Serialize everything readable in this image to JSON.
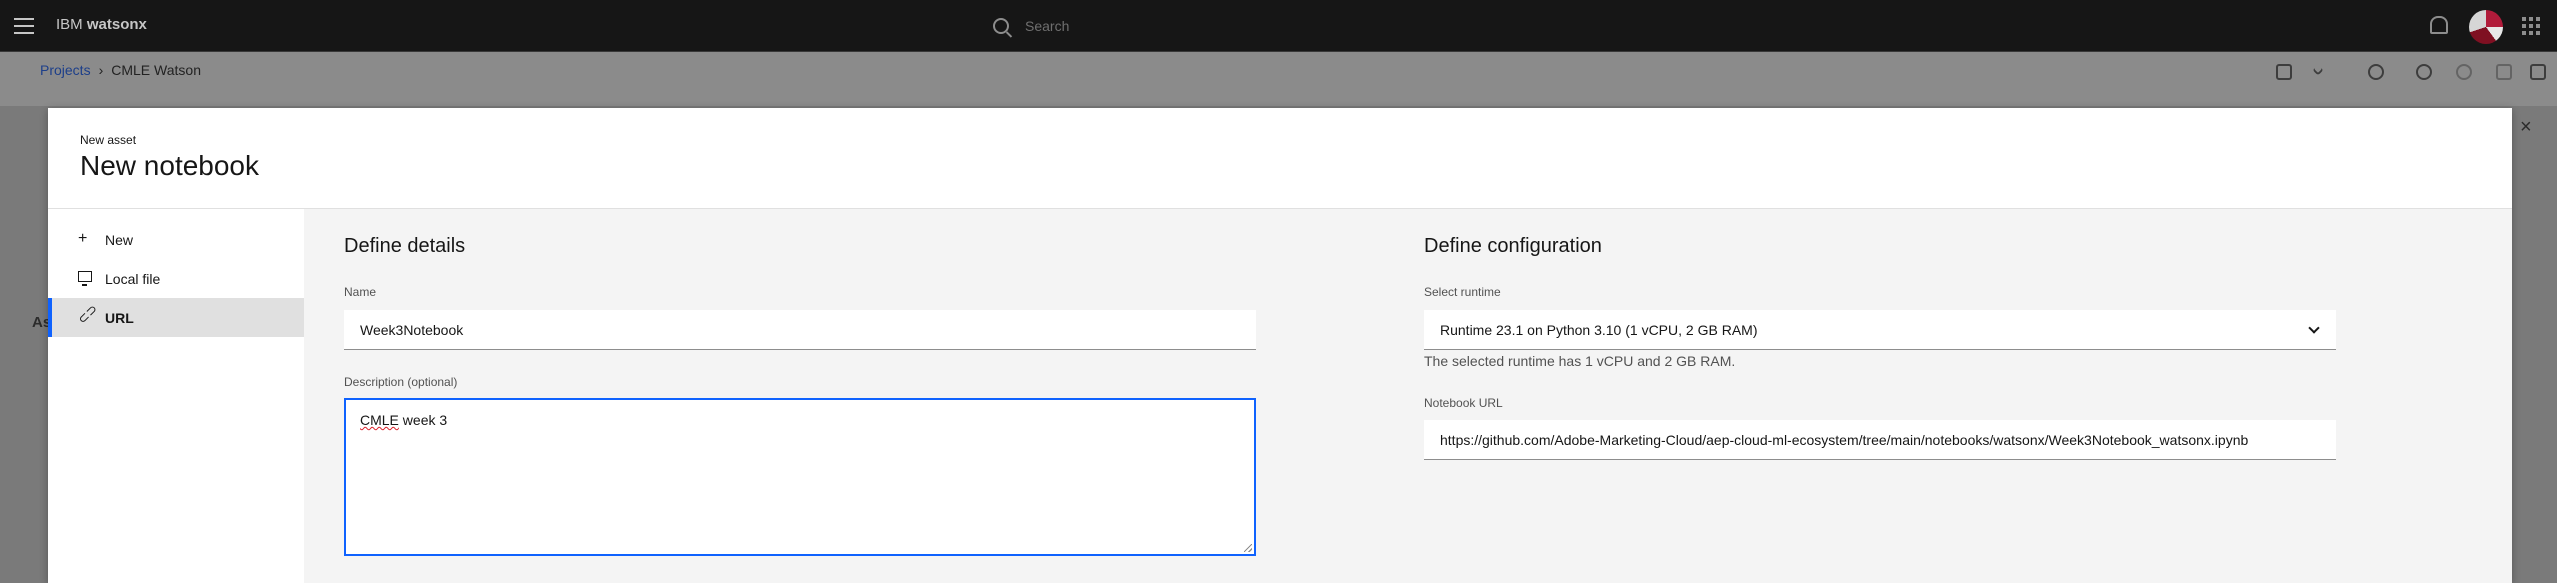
{
  "header": {
    "brand_prefix": "IBM",
    "brand_name": "watsonx",
    "search_placeholder": "Search"
  },
  "breadcrumb": {
    "projects_link": "Projects",
    "separator": "›",
    "current": "CMLE Watson"
  },
  "background_fragments": {
    "assets_partial": "As"
  },
  "modal": {
    "eyebrow": "New asset",
    "title": "New notebook",
    "nav": [
      {
        "label": "New",
        "icon": "plus-icon"
      },
      {
        "label": "Local file",
        "icon": "monitor-icon"
      },
      {
        "label": "URL",
        "icon": "link-icon"
      }
    ],
    "details": {
      "title": "Define details",
      "name_label": "Name",
      "name_value": "Week3Notebook",
      "description_label": "Description (optional)",
      "description_word1": "CMLE",
      "description_rest": " week 3"
    },
    "configuration": {
      "title": "Define configuration",
      "runtime_label": "Select runtime",
      "runtime_value": "Runtime 23.1 on Python 3.10 (1 vCPU, 2 GB RAM)",
      "runtime_helper": "The selected runtime has 1 vCPU and 2 GB RAM.",
      "url_label": "Notebook URL",
      "url_value": "https://github.com/Adobe-Marketing-Cloud/aep-cloud-ml-ecosystem/tree/main/notebooks/watsonx/Week3Notebook_watsonx.ipynb"
    }
  },
  "colors": {
    "accent": "#0f62fe",
    "header_bg": "#161616",
    "overlay": "#7a7a7a"
  }
}
